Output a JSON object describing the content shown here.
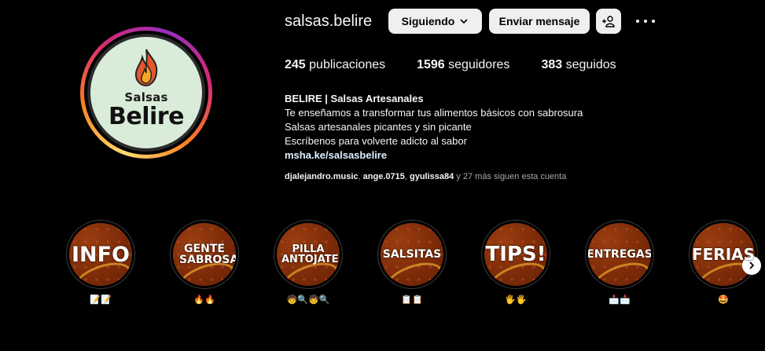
{
  "profile": {
    "username": "salsas.belire",
    "logo_top": "Salsas",
    "logo_main": "Belire",
    "follow_label": "Siguiendo",
    "message_label": "Enviar mensaje"
  },
  "stats": {
    "posts_count": "245",
    "posts_label": "publicaciones",
    "followers_count": "1596",
    "followers_label": "seguidores",
    "following_count": "383",
    "following_label": "seguidos"
  },
  "bio": {
    "name": "BELIRE | Salsas Artesanales",
    "line1": "Te enseñamos a transformar tus alimentos básicos con sabrosura",
    "line2": "Salsas artesanales picantes y sin picante",
    "line3": "Escríbenos para volverte adicto al sabor",
    "link": "msha.ke/salsasbelire"
  },
  "followed_by": {
    "user1": "djalejandro.music",
    "user2": "ange.0715",
    "user3": "gyulissa84",
    "suffix": "y 27 más siguen esta cuenta"
  },
  "highlights": [
    {
      "title": "INFO",
      "emoji": "📝📝"
    },
    {
      "title": "GENTE SABROSA",
      "emoji": "🔥🔥"
    },
    {
      "title": "PILLA ANTOJATE!",
      "emoji": "🧒🔍🧒🔍"
    },
    {
      "title": "SALSITAS",
      "emoji": "📋📋"
    },
    {
      "title": "TIPS!",
      "emoji": "🖐🖐"
    },
    {
      "title": "ENTREGAS",
      "emoji": "📩📩"
    },
    {
      "title": "FERIAS",
      "emoji": "🤩"
    }
  ],
  "colors": {
    "background": "#000000",
    "button_bg": "#efefef",
    "highlight_bg": "#7a2a08",
    "link": "#e0f1ff"
  }
}
